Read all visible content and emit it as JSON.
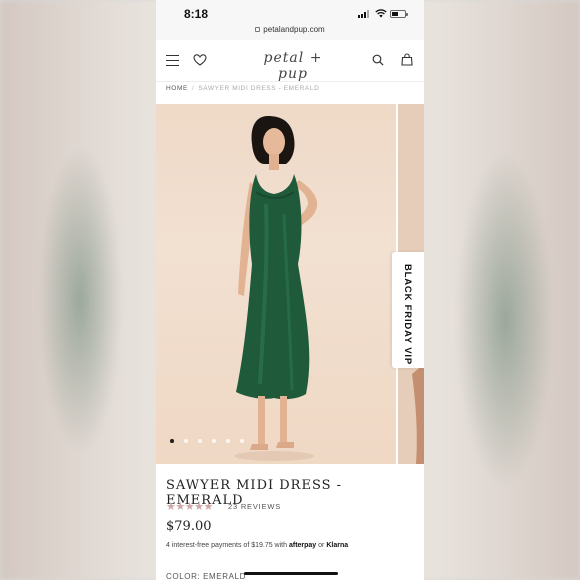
{
  "status_bar": {
    "time": "8:18"
  },
  "browser": {
    "url": "petalandpup.com"
  },
  "header": {
    "logo_text": "petal + pup"
  },
  "breadcrumb": {
    "home": "HOME",
    "separator": "/",
    "current": "SAWYER MIDI DRESS - EMERALD"
  },
  "gallery": {
    "slide_count": 6,
    "active_slide": 1,
    "promo_tab": "BLACK FRIDAY VIP"
  },
  "product": {
    "title": "SAWYER MIDI DRESS - EMERALD",
    "rating": 4.5,
    "rating_stars": "★★★★★",
    "reviews": "23 REVIEWS",
    "price": "$79.00",
    "installments_prefix": "4 interest-free payments of $19.75 with",
    "afterpay": "afterpay",
    "or": "or",
    "klarna": "Klarna",
    "color_label": "COLOR: EMERALD"
  },
  "colors": {
    "dress": "#1f5a3a",
    "star": "#d1a6a6",
    "backdrop": "#efd9c7"
  },
  "icons": [
    "menu-icon",
    "heart-icon",
    "search-icon",
    "bag-icon",
    "lock-icon",
    "star-icon"
  ]
}
